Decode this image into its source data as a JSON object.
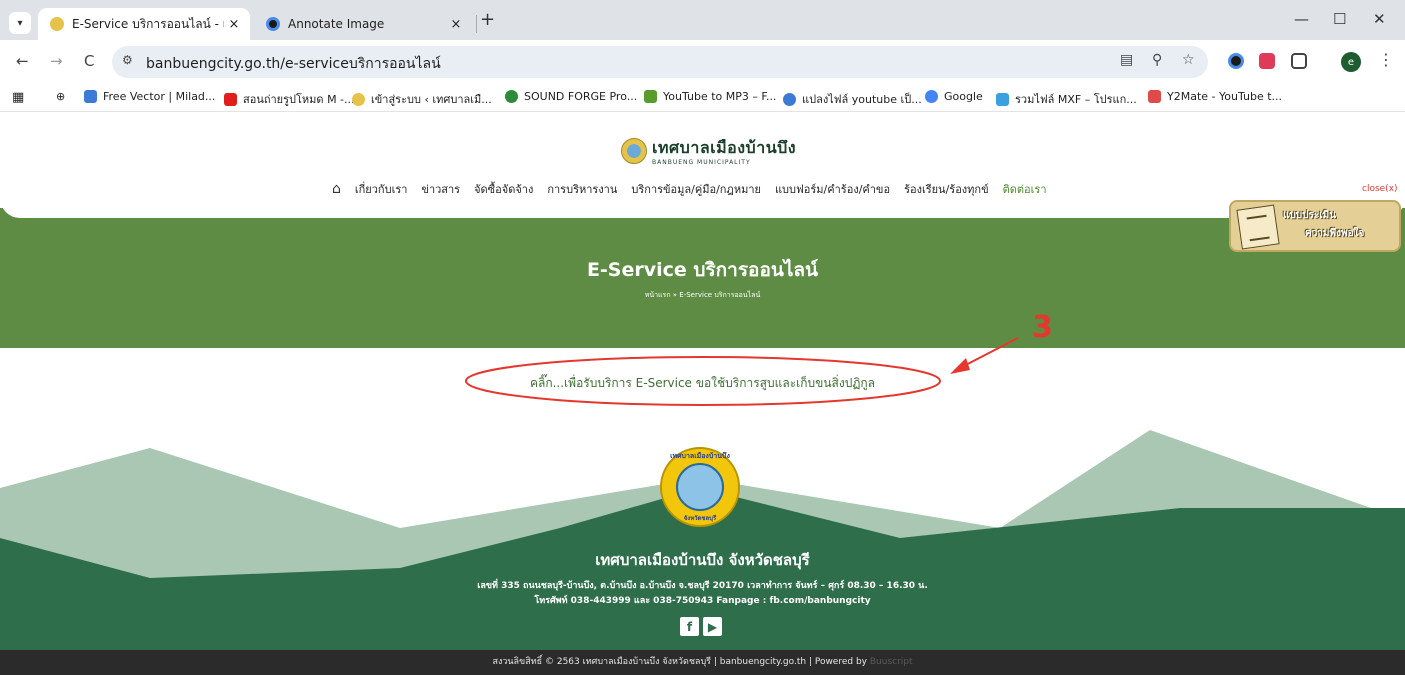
{
  "browser": {
    "tabs": [
      {
        "title": "E-Service บริการออนไลน์ - เทศบาเ",
        "close": "×",
        "active": true
      },
      {
        "title": "Annotate Image",
        "close": "×",
        "active": false
      }
    ],
    "new_tab": "+",
    "window_controls": {
      "minimize": "—",
      "maximize": "☐",
      "close": "✕"
    },
    "url": "banbuengcity.go.th/e-serviceบริการออนไลน์",
    "nav": {
      "back": "←",
      "forward": "→",
      "reload": "C"
    },
    "bookmarks": [
      {
        "label": "Free Vector | Milad...",
        "color": "#3b7bd6"
      },
      {
        "label": "สอนถ่ายรูปโหมด M -...",
        "color": "#e01e1e"
      },
      {
        "label": "เข้าสู่ระบบ ‹ เทศบาลเมื...",
        "color": "#e5c24a"
      },
      {
        "label": "SOUND FORGE Pro...",
        "color": "#2e8b3a"
      },
      {
        "label": "YouTube to MP3 – F...",
        "color": "#5a9b2e"
      },
      {
        "label": "แปลงไฟล์ youtube เป็...",
        "color": "#3b7bd6"
      },
      {
        "label": "Google",
        "color": "#4285f4"
      },
      {
        "label": "รวมไฟล์ MXF – โปรแก...",
        "color": "#3aa0e0"
      },
      {
        "label": "Y2Mate - YouTube t...",
        "color": "#e04a4a"
      }
    ],
    "profile_initial": "e"
  },
  "site": {
    "logo_th": "เทศบาลเมืองบ้านบึง",
    "logo_en": "BANBUENG MUNICIPALITY",
    "nav_items": [
      {
        "label": "เกี่ยวกับเรา",
        "highlight": false
      },
      {
        "label": "ข่าวสาร",
        "highlight": false
      },
      {
        "label": "จัดซื้อจัดจ้าง",
        "highlight": false
      },
      {
        "label": "การบริหารงาน",
        "highlight": false
      },
      {
        "label": "บริการข้อมูล/คู่มือ/กฎหมาย",
        "highlight": false
      },
      {
        "label": "แบบฟอร์ม/คำร้อง/คำขอ",
        "highlight": false
      },
      {
        "label": "ร้องเรียน/ร้องทุกข์",
        "highlight": false
      },
      {
        "label": "ติดต่อเรา",
        "highlight": true
      }
    ],
    "close_label": "close(x)",
    "survey_line1": "แบบประเมิน",
    "survey_line2": "ความพึงพอใจ"
  },
  "hero": {
    "title": "E-Service บริการออนไลน์",
    "breadcrumb": "หน้าแรก » E-Service บริการออนไลน์"
  },
  "content": {
    "link_text": "คลิ๊ก...เพื่อรับบริการ E-Service ขอใช้บริการสูบและเก็บขนสิ่งปฏิกูล"
  },
  "annotation": {
    "number": "3",
    "color": "#e5372e"
  },
  "footer": {
    "seal_top": "เทศบาลเมืองบ้านบึง",
    "seal_bottom": "จังหวัดชลบุรี",
    "name": "เทศบาลเมืองบ้านบึง จังหวัดชลบุรี",
    "address": "เลขที่ 335 ถนนชลบุรี-บ้านบึง, ต.บ้านบึง อ.บ้านบึง จ.ชลบุรี 20170 เวลาทำการ จันทร์ – ศุกร์ 08.30 – 16.30 น.",
    "phone": "โทรศัพท์ 038-443999 และ 038-750943 Fanpage : fb.com/banbungcity",
    "copyright": "สงวนลิขสิทธิ์ © 2563 เทศบาลเมืองบ้านบึง จังหวัดชลบุรี | banbuengcity.go.th | Powered by ",
    "brand": "Buuscript",
    "social": {
      "facebook": "f",
      "youtube": "▶"
    }
  },
  "colors": {
    "hero_green": "#5e8c44",
    "footer_dark_green": "#2e6e4a",
    "mountain_light": "#9dbfa8",
    "accent_link": "#3e6e32"
  }
}
